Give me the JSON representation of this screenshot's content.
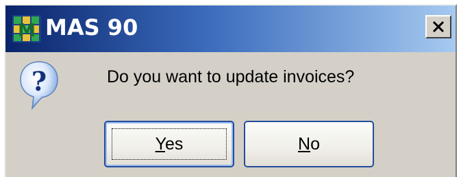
{
  "window": {
    "title": "MAS 90",
    "close_label": "✕"
  },
  "dialog": {
    "icon": "question-icon",
    "message": "Do you want to update invoices?"
  },
  "buttons": {
    "yes": {
      "mnemonic": "Y",
      "rest": "es"
    },
    "no": {
      "mnemonic": "N",
      "rest": "o"
    }
  },
  "colors": {
    "titlebar_start": "#0a246a",
    "titlebar_end": "#a6caf0",
    "dialog_bg": "#d4d0c8",
    "button_border": "#244d9a"
  }
}
